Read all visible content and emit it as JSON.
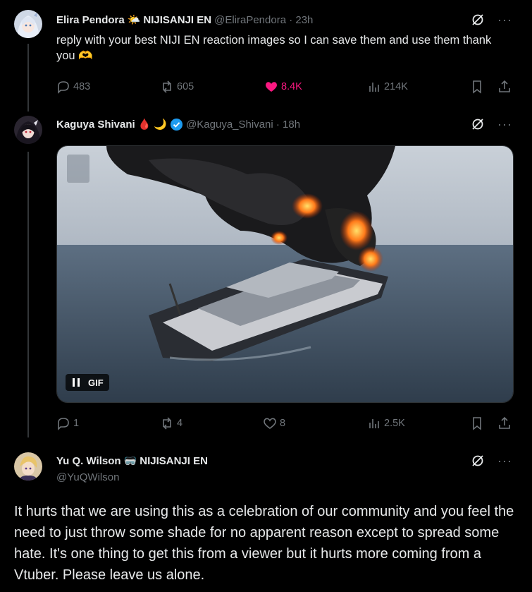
{
  "tweet1": {
    "author_name": "Elira Pendora",
    "emoji1": "🌤️",
    "author_suffix": "NIJISANJI EN",
    "handle_time": "@EliraPendora · 23h",
    "text": "reply with your best NIJI EN reaction images so I can save them and use them thank you 🫶",
    "replies": "483",
    "reposts": "605",
    "likes": "8.4K",
    "views": "214K"
  },
  "tweet2": {
    "author_name": "Kaguya Shivani",
    "emoji1": "🩸",
    "emoji2": "🌙",
    "handle_time": "@Kaguya_Shivani · 18h",
    "gif_badge": "GIF",
    "replies": "1",
    "reposts": "4",
    "likes": "8",
    "views": "2.5K"
  },
  "tweet3": {
    "author_name": "Yu Q. Wilson",
    "emoji1": "🥽",
    "author_suffix": "NIJISANJI EN",
    "handle": "@YuQWilson",
    "text": "It hurts that we are using this as a celebration of our community and you feel the need to just throw some shade for no apparent reason except to spread some hate. It's one thing to get this from a viewer but it hurts more coming from a Vtuber. Please leave us alone."
  },
  "colors": {
    "background": "#000000",
    "text": "#e7e9ea",
    "muted": "#71767b",
    "like_active": "#f91880",
    "verified": "#1d9bf0"
  }
}
